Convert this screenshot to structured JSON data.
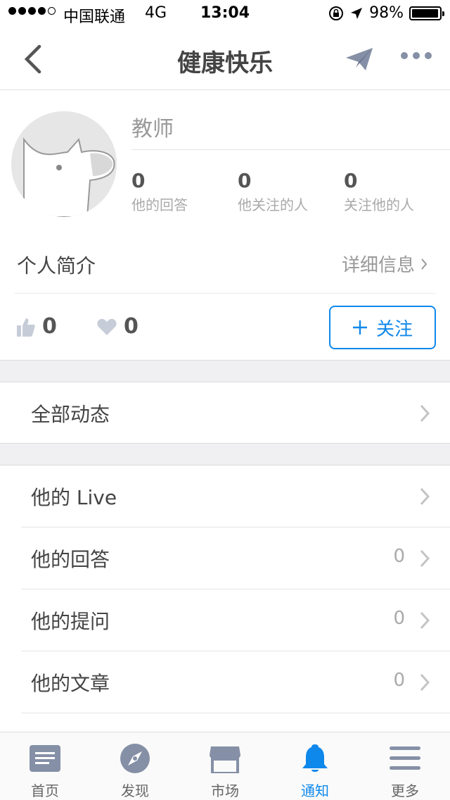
{
  "status_bar": {
    "carrier": "中国联通",
    "network": "4G",
    "time": "13:04",
    "battery": "98%",
    "battery_level": 0.98,
    "signal_bars_filled": 4,
    "signal_bars_total": 5
  },
  "nav": {
    "title": "健康快乐"
  },
  "profile": {
    "role": "教师",
    "stats": [
      {
        "value": "0",
        "label": "他的回答"
      },
      {
        "value": "0",
        "label": "他关注的人"
      },
      {
        "value": "0",
        "label": "关注他的人"
      }
    ]
  },
  "intro": {
    "label": "个人简介",
    "detail_link": "详细信息"
  },
  "reactions": {
    "likes": "0",
    "thanks": "0"
  },
  "follow_button": {
    "label": "关注"
  },
  "sections": {
    "all_activity": "全部动态",
    "items": [
      {
        "label": "他的 Live",
        "count": ""
      },
      {
        "label": "他的回答",
        "count": "0"
      },
      {
        "label": "他的提问",
        "count": "0"
      },
      {
        "label": "他的文章",
        "count": "0"
      }
    ]
  },
  "tabbar": {
    "items": [
      {
        "label": "首页",
        "icon": "home-icon"
      },
      {
        "label": "发现",
        "icon": "compass-icon"
      },
      {
        "label": "市场",
        "icon": "store-icon"
      },
      {
        "label": "通知",
        "icon": "bell-icon"
      },
      {
        "label": "更多",
        "icon": "menu-icon"
      }
    ],
    "active_index": 3
  },
  "colors": {
    "accent": "#0f88eb",
    "icon_gray": "#8590a6"
  }
}
